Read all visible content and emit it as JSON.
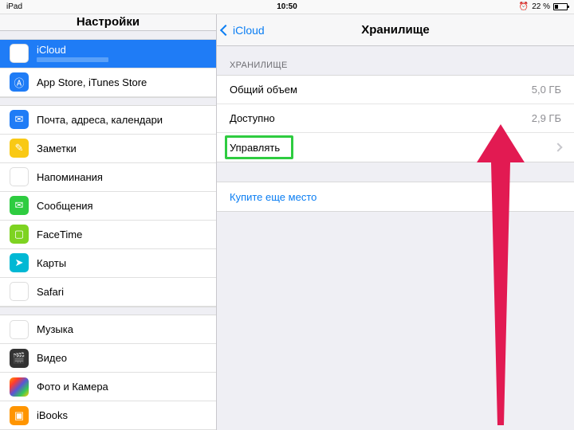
{
  "status": {
    "device": "iPad",
    "time": "10:50",
    "alarm": "⏰",
    "battery_text": "22 %"
  },
  "sidebar_title": "Настройки",
  "nav": {
    "back": "iCloud",
    "title": "Хранилище"
  },
  "storage": {
    "header": "ХРАНИЛИЩЕ",
    "total_label": "Общий объем",
    "total_value": "5,0 ГБ",
    "avail_label": "Доступно",
    "avail_value": "2,9 ГБ",
    "manage_label": "Управлять"
  },
  "upsell": {
    "buy_label": "Купите еще место"
  },
  "sidebar": {
    "icloud": {
      "label": "iCloud",
      "sub": ""
    },
    "appstore": {
      "label": "App Store, iTunes Store"
    },
    "mail": {
      "label": "Почта, адреса, календари"
    },
    "notes": {
      "label": "Заметки"
    },
    "reminders": {
      "label": "Напоминания"
    },
    "messages": {
      "label": "Сообщения"
    },
    "facetime": {
      "label": "FaceTime"
    },
    "maps": {
      "label": "Карты"
    },
    "safari": {
      "label": "Safari"
    },
    "music": {
      "label": "Музыка"
    },
    "video": {
      "label": "Видео"
    },
    "photos": {
      "label": "Фото и Камера"
    },
    "ibooks": {
      "label": "iBooks"
    }
  }
}
